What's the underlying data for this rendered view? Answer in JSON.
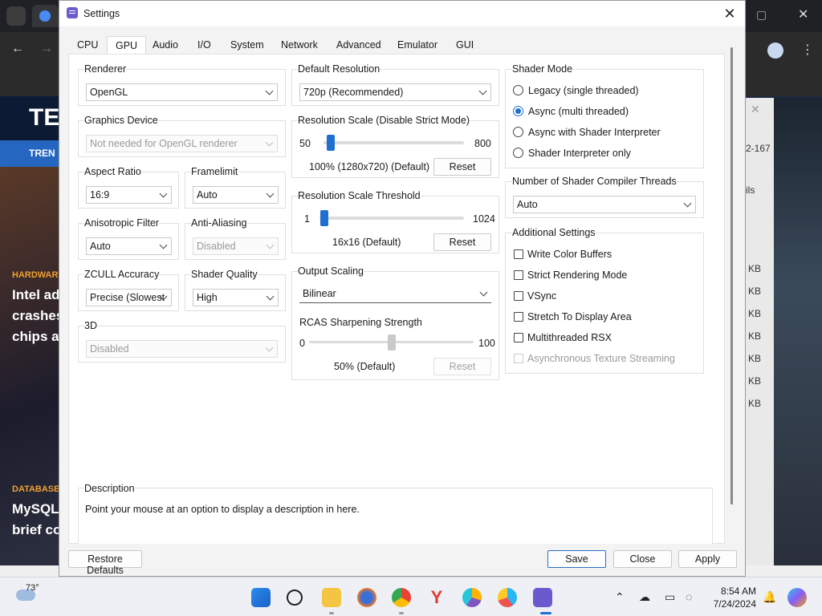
{
  "window": {
    "title": "Settings",
    "close_glyph": "✕"
  },
  "tabs": [
    "CPU",
    "GPU",
    "Audio",
    "I/O",
    "System",
    "Network",
    "Advanced",
    "Emulator",
    "GUI"
  ],
  "active_tab": "GPU",
  "renderer": {
    "title": "Renderer",
    "value": "OpenGL"
  },
  "graphics_device": {
    "title": "Graphics Device",
    "value": "Not needed for OpenGL renderer"
  },
  "aspect_ratio": {
    "title": "Aspect Ratio",
    "value": "16:9"
  },
  "framelimit": {
    "title": "Framelimit",
    "value": "Auto"
  },
  "anisotropic_filter": {
    "title": "Anisotropic Filter",
    "value": "Auto"
  },
  "anti_aliasing": {
    "title": "Anti-Aliasing",
    "value": "Disabled"
  },
  "zcull_accuracy": {
    "title": "ZCULL Accuracy",
    "value": "Precise (Slowest"
  },
  "shader_quality": {
    "title": "Shader Quality",
    "value": "High"
  },
  "three_d": {
    "title": "3D",
    "value": "Disabled"
  },
  "default_resolution": {
    "title": "Default Resolution",
    "value": "720p (Recommended)"
  },
  "resolution_scale": {
    "title": "Resolution Scale (Disable Strict Mode)",
    "min": "50",
    "max": "800",
    "value_fraction": 0.0,
    "status": "100% (1280x720) (Default)",
    "reset": "Reset"
  },
  "resolution_scale_threshold": {
    "title": "Resolution Scale Threshold",
    "min": "1",
    "max": "1024",
    "value_fraction": 0.0,
    "status": "16x16 (Default)",
    "reset": "Reset"
  },
  "output_scaling": {
    "title": "Output Scaling",
    "value": "Bilinear"
  },
  "rcas": {
    "title": "RCAS Sharpening Strength",
    "min": "0",
    "max": "100",
    "value_fraction": 0.5,
    "status": "50% (Default)",
    "reset": "Reset"
  },
  "shader_mode": {
    "title": "Shader Mode",
    "options": [
      "Legacy (single threaded)",
      "Async (multi threaded)",
      "Async with Shader Interpreter",
      "Shader Interpreter only"
    ],
    "selected_index": 1
  },
  "shader_compiler_threads": {
    "title": "Number of Shader Compiler Threads",
    "value": "Auto"
  },
  "additional_settings": {
    "title": "Additional Settings",
    "options": [
      "Write Color Buffers",
      "Strict Rendering Mode",
      "VSync",
      "Stretch To Display Area",
      "Multithreaded RSX",
      "Asynchronous Texture Streaming"
    ],
    "checked": [
      false,
      false,
      false,
      false,
      false,
      false
    ],
    "disabled": [
      false,
      false,
      false,
      false,
      false,
      true
    ]
  },
  "description": {
    "title": "Description",
    "text": "Point your mouse at an option to display a description in here."
  },
  "footer": {
    "restore": "Restore Defaults",
    "save": "Save",
    "close": "Close",
    "apply": "Apply"
  },
  "background": {
    "labels": [
      "HARDWAR",
      "DATABASE"
    ],
    "headlines": [
      "Intel ad",
      "crashes",
      "chips a",
      "MySQL",
      "brief co"
    ],
    "logo": "TE",
    "nav": "TREN",
    "kb_suffix": "KB",
    "side_text_1": "2-167",
    "side_text_2": "ils"
  },
  "taskbar": {
    "temperature": "73°",
    "time": "8:54 AM",
    "date": "7/24/2024"
  },
  "colors": {
    "accent": "#1f6fd1",
    "dialog_bg": "#f3f3f3",
    "group_border": "#dfdfdf"
  }
}
